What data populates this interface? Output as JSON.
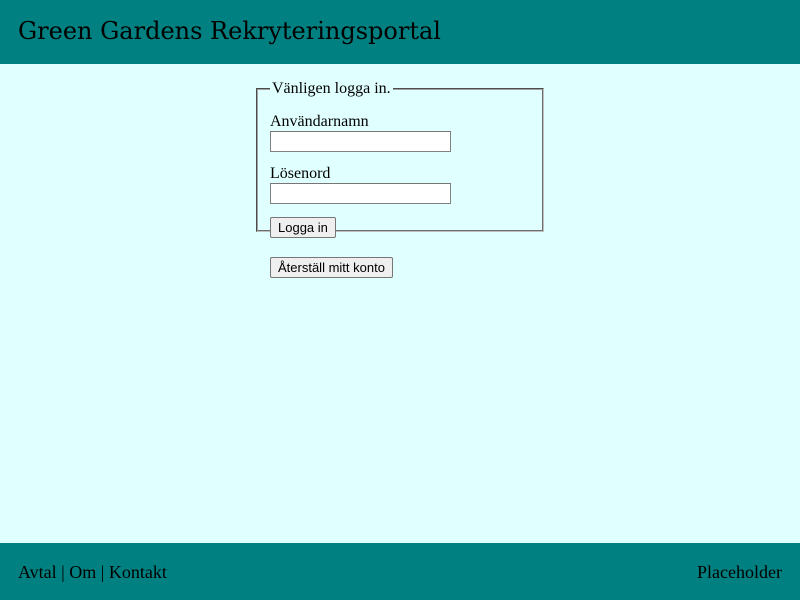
{
  "header": {
    "title": "Green Gardens Rekryteringsportal"
  },
  "login": {
    "legend": "Vänligen logga in.",
    "username_label": "Användarnamn",
    "username_value": "",
    "password_label": "Lösenord",
    "password_value": "",
    "submit_label": "Logga in"
  },
  "reset": {
    "label": "Återställ mitt konto"
  },
  "footer": {
    "links": [
      "Avtal",
      "Om",
      "Kontakt"
    ],
    "separator": "|",
    "right_text": "Placeholder"
  },
  "colors": {
    "header_bg": "#008080",
    "page_bg": "#e0ffff",
    "footer_bg": "#008080"
  }
}
